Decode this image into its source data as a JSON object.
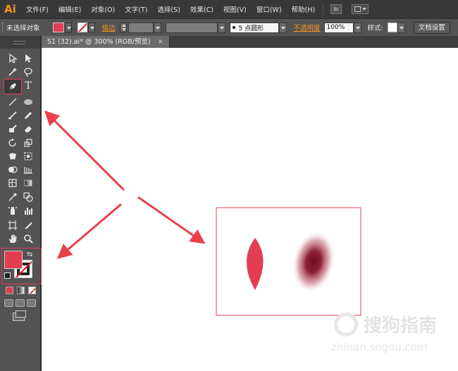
{
  "app": {
    "logo_text": "Ai",
    "accent_color": "#f7941d"
  },
  "menubar": {
    "items": [
      "文件(F)",
      "编辑(E)",
      "对象(O)",
      "文字(T)",
      "选择(S)",
      "效果(C)",
      "视图(V)",
      "窗口(W)",
      "帮助(H)"
    ],
    "bridge_label": "Br"
  },
  "controlbar": {
    "selection_status": "未选择对象",
    "fill_color": "#e33d52",
    "stroke_label": "描边",
    "brush_value": "5 点圆形",
    "opacity_label": "不透明度",
    "opacity_value": "100%",
    "style_label": "样式:",
    "doc_setup_button": "文档设置"
  },
  "document": {
    "tab_title": "S1 (32).ai* @ 300% (RGB/预览)",
    "tab_close": "×"
  },
  "toolbox": {
    "active_tool": "pen-tool",
    "fill_color": "#e33d52",
    "tools": [
      "selection",
      "direct-selection",
      "magic-wand",
      "lasso",
      "pen",
      "type",
      "line-segment",
      "ellipse",
      "paintbrush",
      "pencil",
      "blob-brush",
      "eraser",
      "rotate",
      "scale",
      "warp",
      "free-transform",
      "shape-builder",
      "perspective-grid",
      "mesh",
      "gradient",
      "eyedropper",
      "blend",
      "symbol-sprayer",
      "column-graph",
      "artboard",
      "slice",
      "hand",
      "zoom"
    ]
  },
  "annotation": {
    "arrow_color": "#e8414b",
    "highlight_color": "#e33d52"
  },
  "artwork": {
    "leaf_color": "#e33d52",
    "blur_color_center": "#7a1020",
    "blur_color_edge": "#c05060"
  },
  "watermark": {
    "brand": "搜狗指南",
    "url": "zhinan.sogou.com"
  }
}
